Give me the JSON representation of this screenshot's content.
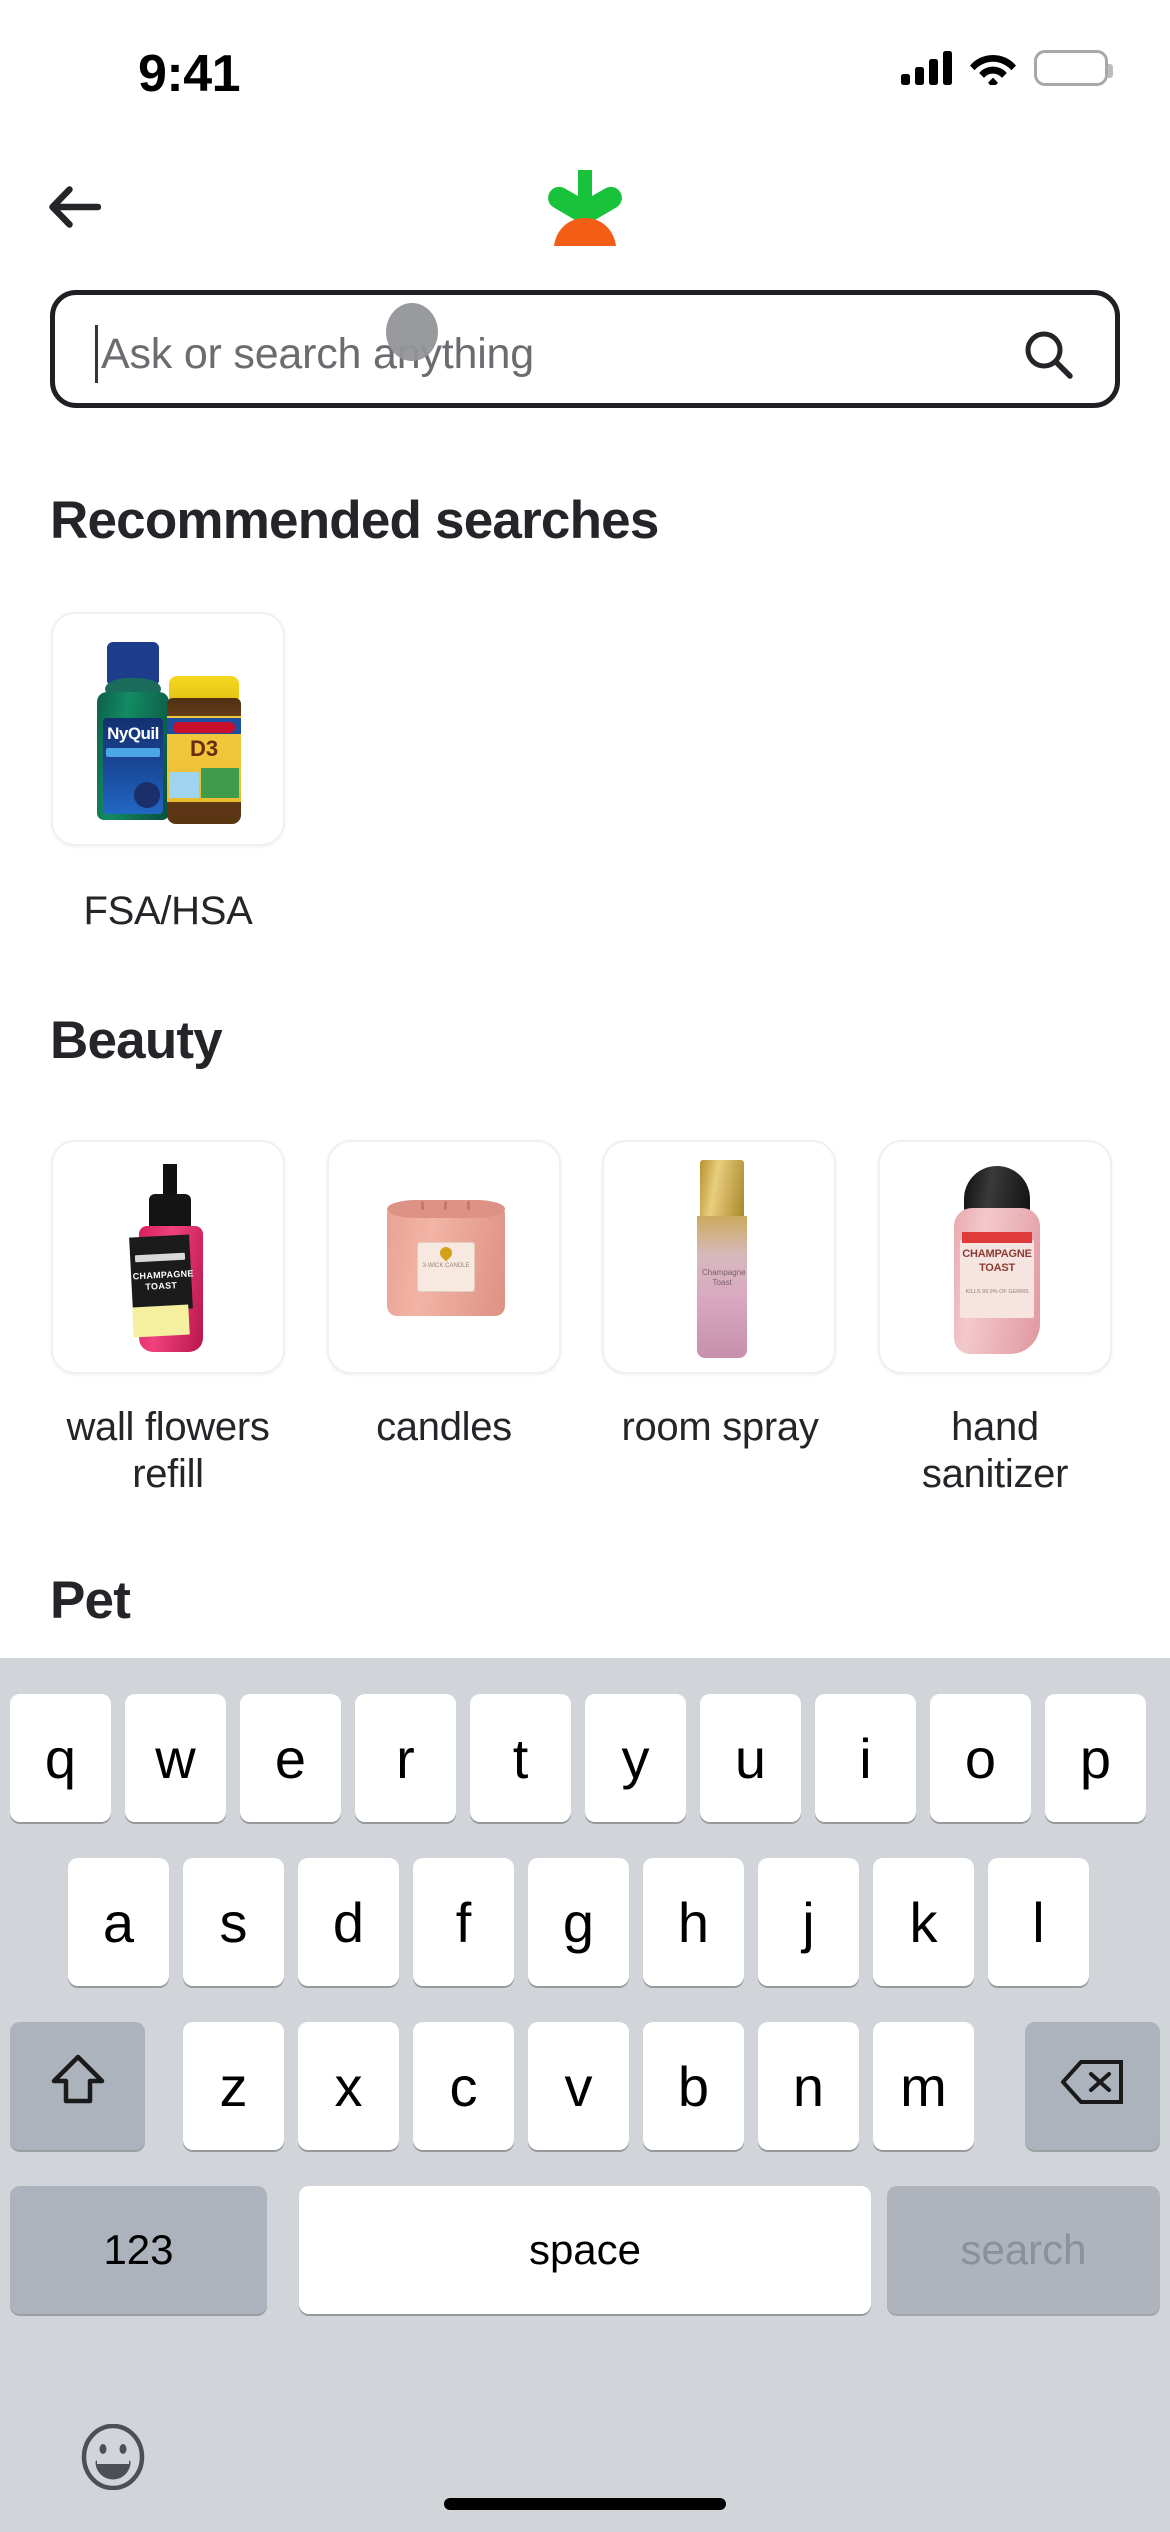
{
  "status_bar": {
    "time": "9:41",
    "cellular_icon": "cellular-signal-icon",
    "wifi_icon": "wifi-icon",
    "battery_icon": "battery-full-icon"
  },
  "nav": {
    "back_icon": "back-arrow-icon",
    "logo": "instacart-carrot-logo",
    "logo_colors": {
      "leaf": "#19c23b",
      "carrot": "#f25e16"
    }
  },
  "search": {
    "value": "",
    "placeholder": "Ask or search anything",
    "submit_icon": "search-icon",
    "caret_visible": true
  },
  "sections": [
    {
      "title": "Recommended searches",
      "tiles": [
        {
          "label": "FSA/HSA",
          "image": "nyquil-and-nature-made-d3-bottles"
        }
      ]
    },
    {
      "title": "Beauty",
      "tiles": [
        {
          "label": "wall flowers refill",
          "image": "wallflower-refill-champagne-toast"
        },
        {
          "label": "candles",
          "image": "pink-3-wick-candle"
        },
        {
          "label": "room spray",
          "image": "gold-pink-room-spray-champagne-toast"
        },
        {
          "label": "hand sanitizer",
          "image": "pocketbac-hand-sanitizer-champagne-toast"
        }
      ]
    },
    {
      "title": "Pet",
      "tiles": []
    }
  ],
  "product_art": {
    "nyquil_brand": "NyQuil",
    "d3_brand": "D3",
    "wallflower_scent": "CHAMPAGNE TOAST",
    "sanitizer_scent": "CHAMPAGNE TOAST",
    "sanitizer_sub": "KILLS 99.9% OF GERMS",
    "candle_sub": "3-WICK CANDLE",
    "roomspray_scent": "Champagne Toast"
  },
  "keyboard": {
    "row1": [
      "q",
      "w",
      "e",
      "r",
      "t",
      "y",
      "u",
      "i",
      "o",
      "p"
    ],
    "row2": [
      "a",
      "s",
      "d",
      "f",
      "g",
      "h",
      "j",
      "k",
      "l"
    ],
    "row3": [
      "z",
      "x",
      "c",
      "v",
      "b",
      "n",
      "m"
    ],
    "shift_icon": "shift-arrow-icon",
    "backspace_icon": "backspace-delete-icon",
    "numeric_label": "123",
    "space_label": "space",
    "return_label": "search",
    "emoji_icon": "emoji-smiley-icon",
    "background_color": "#d1d4d9",
    "key_color": "#ffffff",
    "modifier_color": "#adb3bd"
  },
  "home_indicator": "home-indicator-bar",
  "touch_indicator": "touch-point-indicator"
}
